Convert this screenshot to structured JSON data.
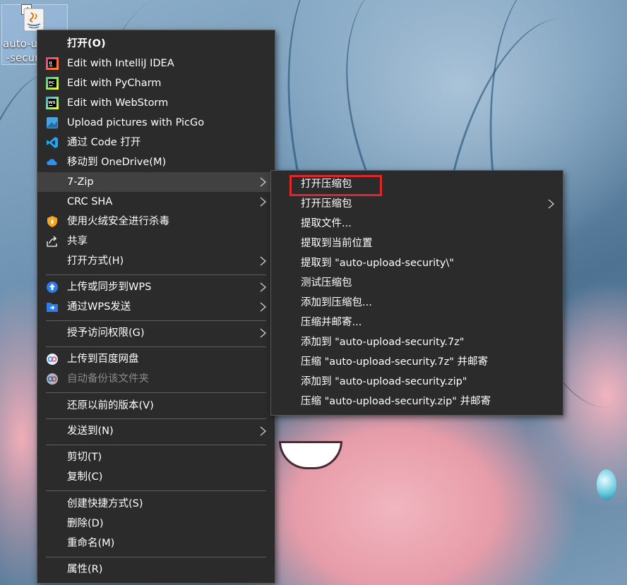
{
  "desktop": {
    "icon_label": "auto-up\n-secur"
  },
  "context_menu": {
    "items": [
      {
        "label": "打开(O)",
        "icon": "none",
        "bold": true
      },
      {
        "label": "Edit with IntelliJ IDEA",
        "icon": "intellij-icon"
      },
      {
        "label": "Edit with PyCharm",
        "icon": "pycharm-icon"
      },
      {
        "label": "Edit with WebStorm",
        "icon": "webstorm-icon"
      },
      {
        "label": "Upload pictures with PicGo",
        "icon": "picgo-icon"
      },
      {
        "label": "通过 Code 打开",
        "icon": "vscode-icon"
      },
      {
        "label": "移动到 OneDrive(M)",
        "icon": "onedrive-icon"
      },
      {
        "label": "7-Zip",
        "icon": "none",
        "submenu": true,
        "highlighted": true
      },
      {
        "label": "CRC SHA",
        "icon": "none",
        "submenu": true
      },
      {
        "label": "使用火绒安全进行杀毒",
        "icon": "huorong-shield-icon"
      },
      {
        "label": "共享",
        "icon": "share-icon"
      },
      {
        "label": "打开方式(H)",
        "icon": "none",
        "submenu": true
      },
      {
        "label": "上传或同步到WPS",
        "icon": "wps-cloud-icon",
        "submenu": true
      },
      {
        "label": "通过WPS发送",
        "icon": "wps-send-icon",
        "submenu": true
      },
      {
        "label": "授予访问权限(G)",
        "icon": "none",
        "submenu": true
      },
      {
        "label": "上传到百度网盘",
        "icon": "baidu-netdisk-icon"
      },
      {
        "label": "自动备份该文件夹",
        "icon": "baidu-netdisk-icon",
        "disabled": true
      },
      {
        "label": "还原以前的版本(V)",
        "icon": "none"
      },
      {
        "label": "发送到(N)",
        "icon": "none",
        "submenu": true
      },
      {
        "label": "剪切(T)",
        "icon": "none"
      },
      {
        "label": "复制(C)",
        "icon": "none"
      },
      {
        "label": "创建快捷方式(S)",
        "icon": "none"
      },
      {
        "label": "删除(D)",
        "icon": "none"
      },
      {
        "label": "重命名(M)",
        "icon": "none"
      },
      {
        "label": "属性(R)",
        "icon": "none"
      }
    ]
  },
  "zip_submenu": {
    "items": [
      {
        "label": "打开压缩包"
      },
      {
        "label": "打开压缩包",
        "submenu": true
      },
      {
        "label": "提取文件..."
      },
      {
        "label": "提取到当前位置"
      },
      {
        "label": "提取到 \"auto-upload-security\\\""
      },
      {
        "label": "测试压缩包"
      },
      {
        "label": "添加到压缩包..."
      },
      {
        "label": "压缩并邮寄..."
      },
      {
        "label": "添加到 \"auto-upload-security.7z\""
      },
      {
        "label": "压缩 \"auto-upload-security.7z\" 并邮寄"
      },
      {
        "label": "添加到 \"auto-upload-security.zip\""
      },
      {
        "label": "压缩 \"auto-upload-security.zip\" 并邮寄"
      }
    ],
    "highlight_color": "#e0262b"
  }
}
